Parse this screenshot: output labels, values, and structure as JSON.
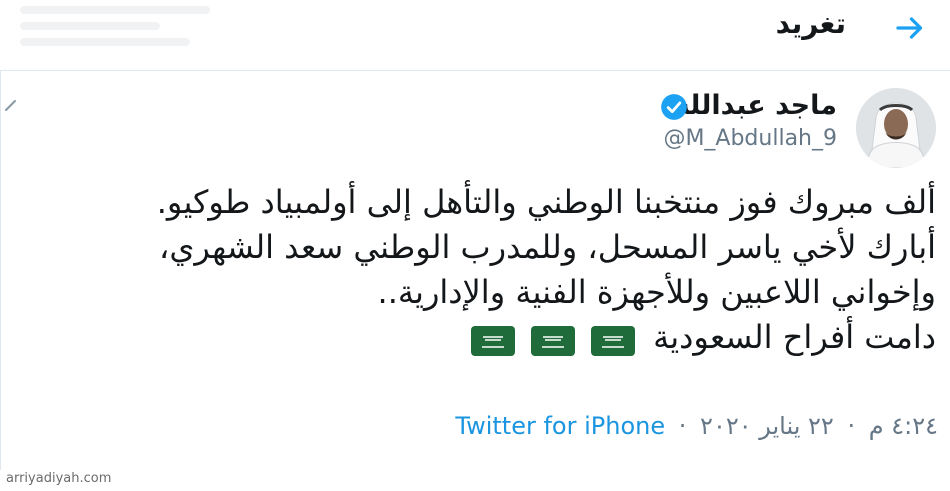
{
  "header": {
    "title": "تغريد",
    "back_icon": "arrow-right-icon"
  },
  "tweet": {
    "display_name": "ماجد عبدالله",
    "handle": "@M_Abdullah_9",
    "verified_icon": "verified-badge-icon",
    "lines": [
      "ألف مبروك فوز منتخبنا الوطني والتأهل إلى أولمبياد طوكيو.",
      "أبارك لأخي ياسر المسحل، وللمدرب الوطني سعد الشهري،",
      "وإخواني اللاعبين وللأجهزة الفنية والإدارية..",
      "دامت أفراح السعودية"
    ],
    "flags": [
      "saudi-flag-icon",
      "saudi-flag-icon",
      "saudi-flag-icon"
    ],
    "time": "٤:٢٤ م",
    "date": "٢٢ يناير ٢٠٢٠",
    "separator": "·",
    "source": "Twitter for iPhone"
  },
  "watermark": "arriyadiyah.com",
  "colors": {
    "link": "#1b95e0",
    "verified": "#1da1f2",
    "secondary_text": "#657786",
    "flag_green": "#1f6b3a"
  }
}
